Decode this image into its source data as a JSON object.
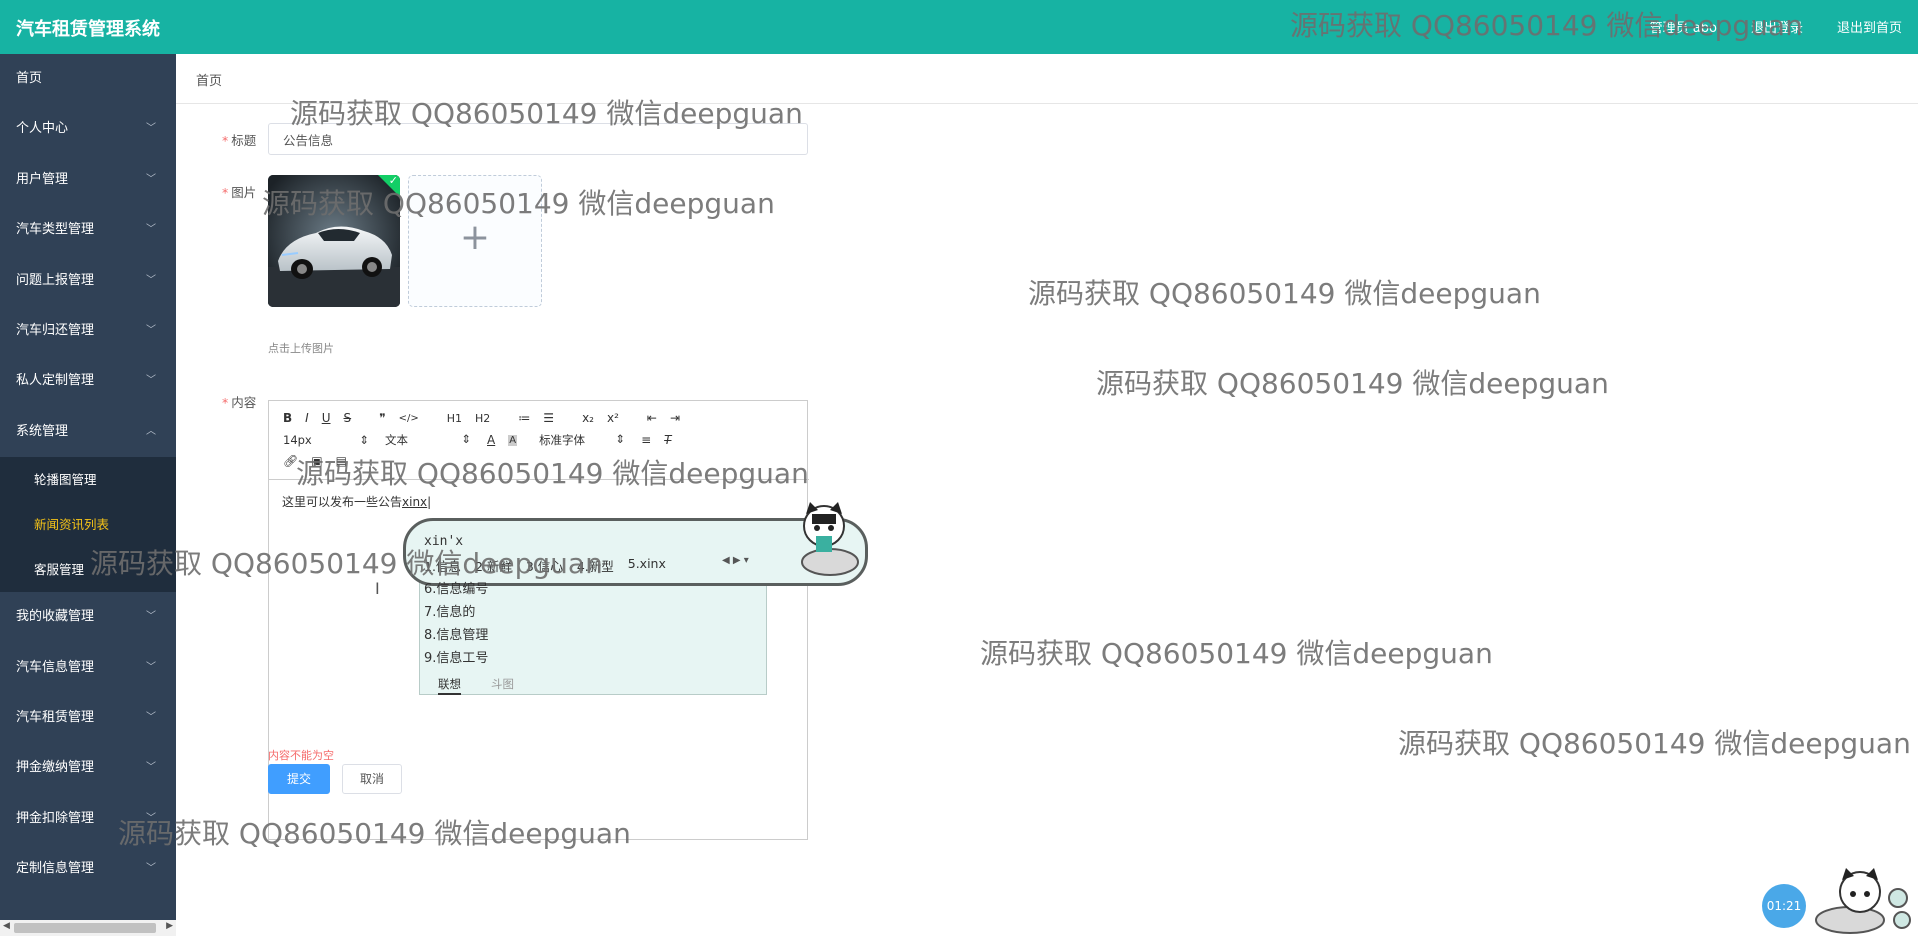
{
  "header": {
    "app_title": "汽车租赁管理系统",
    "links": [
      "管理员 abo",
      "退出登录",
      "退出到首页"
    ]
  },
  "sidebar": {
    "items": [
      {
        "label": "首页",
        "has_chevron": false
      },
      {
        "label": "个人中心",
        "has_chevron": true
      },
      {
        "label": "用户管理",
        "has_chevron": true
      },
      {
        "label": "汽车类型管理",
        "has_chevron": true
      },
      {
        "label": "问题上报管理",
        "has_chevron": true
      },
      {
        "label": "汽车归还管理",
        "has_chevron": true
      },
      {
        "label": "私人定制管理",
        "has_chevron": true
      },
      {
        "label": "系统管理",
        "has_chevron": true,
        "expanded": true
      }
    ],
    "sub_items": [
      {
        "label": "轮播图管理",
        "active": false
      },
      {
        "label": "新闻资讯列表",
        "active": true
      },
      {
        "label": "客服管理",
        "active": false
      }
    ],
    "items_after": [
      {
        "label": "我的收藏管理"
      },
      {
        "label": "汽车信息管理"
      },
      {
        "label": "汽车租赁管理"
      },
      {
        "label": "押金缴纳管理"
      },
      {
        "label": "押金扣除管理"
      },
      {
        "label": "定制信息管理"
      }
    ]
  },
  "breadcrumb": "首页",
  "form": {
    "title_label": "标题",
    "title_value": "公告信息",
    "image_label": "图片",
    "upload_hint": "点击上传图片",
    "content_label": "内容",
    "editor": {
      "toolbar_row1": [
        "B",
        "I",
        "U",
        "S",
        "❞",
        "</>",
        "H1",
        "H2",
        "≔",
        "☰",
        "x₂",
        "x²",
        "⇤",
        "⇥"
      ],
      "font_size": "14px",
      "block_type": "文本",
      "font_family": "标准字体",
      "content_text": "这里可以发布一些公告",
      "content_typing": "xinx"
    },
    "error": "内容不能为空",
    "submit_label": "提交",
    "cancel_label": "取消"
  },
  "ime": {
    "pinyin": "xin'x",
    "candidates_row": [
      "1.信息",
      "2.新鲜",
      "3.信心",
      "4.新型",
      "5.xinx"
    ],
    "candidates_list": [
      "6.信息编号",
      "7.信息的",
      "8.信息管理",
      "9.信息工号"
    ],
    "tabs": [
      "联想",
      "斗图"
    ]
  },
  "watermark": "源码获取 QQ86050149 微信deepguan",
  "timer": "01:21",
  "colors": {
    "topbar": "#17b3a3",
    "sidebar": "#304156",
    "active_menu": "#f5c318",
    "primary": "#409eff",
    "error": "#f56c6c"
  }
}
